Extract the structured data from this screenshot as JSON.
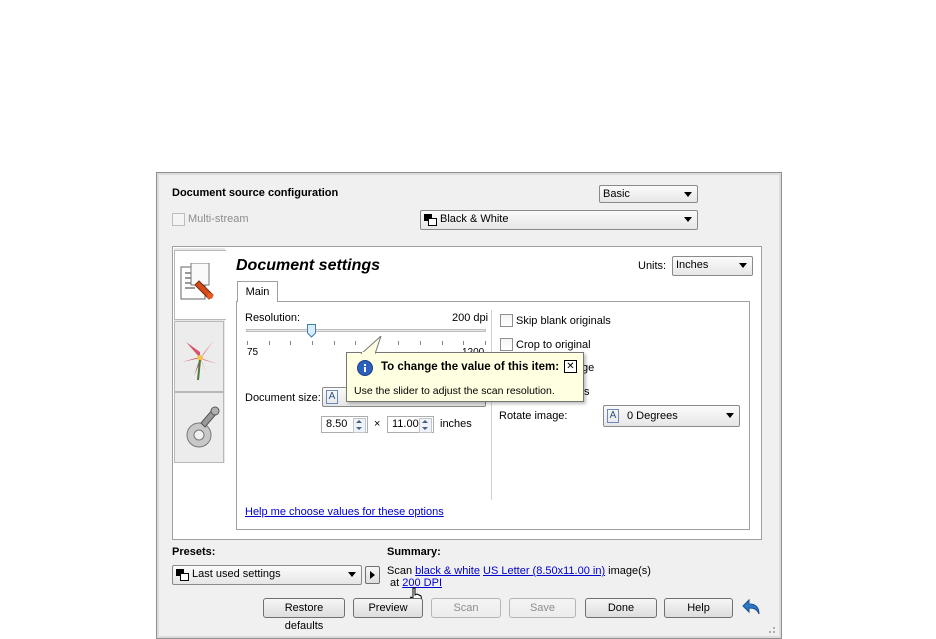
{
  "source": {
    "title": "Document source configuration",
    "mode": "Basic",
    "multistream_label": "Multi-stream",
    "color_mode": "Black & White"
  },
  "doc_settings": {
    "title": "Document settings",
    "units_label": "Units:",
    "units_value": "Inches",
    "tab_main": "Main",
    "resolution_label": "Resolution:",
    "resolution_value": "200 dpi",
    "slider_min": "75",
    "slider_max": "1200",
    "slider_fraction": 0.27,
    "document_size_label": "Document size:",
    "width": "8.50",
    "times": "×",
    "height": "11.00",
    "inches": "inches",
    "options": {
      "skip_blank": "Skip blank originals",
      "crop": "Crop to original",
      "straighten_suffix": "ge",
      "more_suffix": "s"
    },
    "rotate_label": "Rotate image:",
    "rotate_value": "0 Degrees",
    "help_link": "Help me choose values for these options"
  },
  "tooltip": {
    "title": "To change the value of this item:",
    "body": "Use the slider to adjust the scan resolution.",
    "close": "✕"
  },
  "presets": {
    "label": "Presets:",
    "value": "Last used settings"
  },
  "summary": {
    "label": "Summary:",
    "scan": "Scan",
    "color_link": "black & white",
    "size_link": "US Letter (8.50x11.00 in)",
    "images": "image(s)",
    "at": "at",
    "dpi_link": "200 DPI"
  },
  "buttons": {
    "restore": "Restore defaults",
    "preview": "Preview",
    "scan": "Scan",
    "save": "Save",
    "done": "Done",
    "help": "Help"
  },
  "colors": {
    "link": "#0000cc",
    "tooltip_bg": "#ffffe1",
    "info_icon": "#2d5fbf"
  }
}
